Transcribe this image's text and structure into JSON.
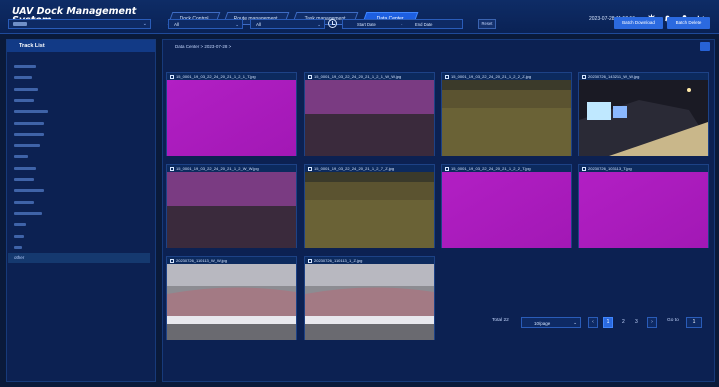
{
  "header": {
    "title": "UAV Dock Management System",
    "tabs": [
      {
        "label": "Dock Control",
        "active": false
      },
      {
        "label": "Route management",
        "active": false
      },
      {
        "label": "Task management",
        "active": false
      },
      {
        "label": "Data Center",
        "active": true
      }
    ],
    "datetime": "2023-07-28 11:52:56",
    "icons": [
      "gear-icon",
      "bell-icon",
      "user-icon",
      "logout-icon"
    ]
  },
  "sidebar": {
    "title": "Track List",
    "selected_value": "",
    "items": [
      {
        "label": ""
      },
      {
        "label": ""
      },
      {
        "label": ""
      },
      {
        "label": ""
      },
      {
        "label": ""
      },
      {
        "label": ""
      },
      {
        "label": ""
      },
      {
        "label": ""
      },
      {
        "label": ""
      },
      {
        "label": ""
      },
      {
        "label": ""
      },
      {
        "label": ""
      },
      {
        "label": ""
      },
      {
        "label": ""
      },
      {
        "label": ""
      },
      {
        "label": ""
      },
      {
        "label": ""
      },
      {
        "label": "other",
        "selected": true
      }
    ]
  },
  "main": {
    "breadcrumb": "Data Center > 2023-07-28 >",
    "filter1": "All",
    "filter2": "All",
    "start_date_placeholder": "Start Date",
    "range_separator": "-",
    "end_date_placeholder": "End Date",
    "reset_label": "Reset",
    "batch_download_label": "Batch Download",
    "batch_delete_label": "Batch Delete",
    "cards": [
      {
        "name": "15_0001_19_03_22_24_20_21_1_2_1_T.jpg",
        "thumb": "magenta"
      },
      {
        "name": "15_0001_19_03_22_24_20_21_1_2_1_W_W.jpg",
        "thumb": "dark-violet"
      },
      {
        "name": "15_0001_19_03_22_24_20_21_1_2_2_Z.jpg",
        "thumb": "olive"
      },
      {
        "name": "20230726_143211_W_W.jpg",
        "thumb": "night-city"
      },
      {
        "name": "15_0001_19_03_22_24_20_21_1_2_W_W.jpg",
        "thumb": "dark-violet"
      },
      {
        "name": "15_0001_19_03_22_24_20_21_1_2_7_Z.jpg",
        "thumb": "olive"
      },
      {
        "name": "15_0001_19_03_22_24_20_21_1_2_2_T.jpg",
        "thumb": "magenta"
      },
      {
        "name": "20230726_103113_T.jpg",
        "thumb": "magenta"
      },
      {
        "name": "20230726_110113_W_W.jpg",
        "thumb": "gray-room"
      },
      {
        "name": "20230726_110113_1_Z.jpg",
        "thumb": "gray-room"
      }
    ],
    "pagination": {
      "total_label": "Total 22",
      "page_size": "10/page",
      "pages": [
        "1",
        "2",
        "3"
      ],
      "current_page": "1",
      "goto_label": "Go to",
      "goto_value": "1"
    }
  }
}
